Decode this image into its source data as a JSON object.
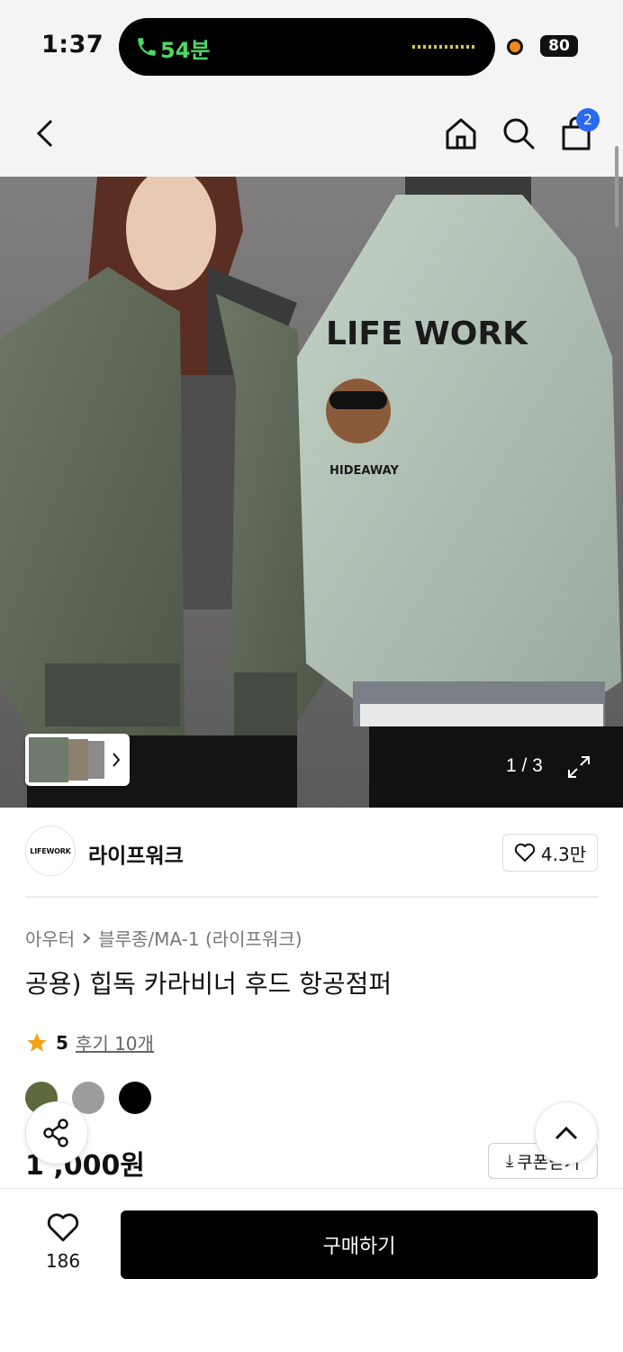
{
  "status_bar": {
    "time": "1:37",
    "call_duration": "54분",
    "battery": "80"
  },
  "header": {
    "cart_count": "2"
  },
  "gallery": {
    "counter": "1 / 3",
    "photo_text": {
      "back_print_top": "LIFE WORK",
      "back_print_bottom": "HIDEAWAY"
    }
  },
  "brand": {
    "logo_text": "LIFEWORK",
    "name": "라이프워크",
    "likes": "4.3만"
  },
  "breadcrumb": {
    "category": "아우터",
    "subcategory": "블루종/MA-1 (라이프워크)"
  },
  "product": {
    "title": "공용) 힙독 카라비너 후드 항공점퍼",
    "rating": "5",
    "reviews": "후기 10개",
    "price": "1 ,000원",
    "coupon_label": "쿠폰받기",
    "colors": [
      "#5e6a3e",
      "#9c9c9c",
      "#000000"
    ]
  },
  "bottom_bar": {
    "wish_count": "186",
    "buy_label": "구매하기"
  }
}
